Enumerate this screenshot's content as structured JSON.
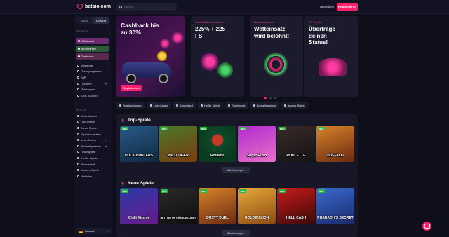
{
  "header": {
    "logo_text": "betsio.com",
    "search_placeholder": "Suche",
    "login_label": "Anmelden",
    "register_label": "Registrieren"
  },
  "sidebar": {
    "toggle": [
      "Sport",
      "Casino"
    ],
    "section_label_promo": "PROMOS",
    "pills": [
      "Glücksrad",
      "$ Einzahlen",
      "Cashback"
    ],
    "items_top": [
      "Angebote",
      "Treueprogramm",
      "VIP",
      "Turniere",
      "Zahlungen",
      "Live-Support"
    ],
    "section_label_games": "SPIELE",
    "items_games": [
      "Kollektionen",
      "Top-Spiele",
      "Neue Spiele",
      "Spielautomaten",
      "Live-Casino",
      "Schnellgewinne",
      "Tischspiele",
      "Heiße Spiele",
      "Bonuskauf",
      "Andere Spiele",
      "Anbieter"
    ],
    "language": "Deutsch"
  },
  "promos": {
    "main_title": "Cashback bis zu 30%",
    "main_cta": "Registrieren",
    "cards": [
      {
        "tag": "Casino Willkommensbonus",
        "title": "225% + 225 FS"
      },
      {
        "tag": "Wetteinsatzbonus",
        "title": "Wetteinsatz wird belohnt!"
      },
      {
        "tag": "VIP Transfer",
        "title": "Übertrage deinen Status!"
      }
    ]
  },
  "categories": [
    "Spielautomaten",
    "Live-Casino",
    "Bonuskauf",
    "Heiße Spiele",
    "Tischspiele",
    "Schnellgewinne",
    "Andere Spiele"
  ],
  "sections": [
    {
      "title": "Top-Spiele",
      "show_all": "Alle Anzeigen",
      "games": [
        {
          "name": "DUCK HUNTERS",
          "badge": "NEU"
        },
        {
          "name": "WILD TIGER",
          "badge": "NEU"
        },
        {
          "name": "Roulette",
          "badge": "NEU"
        },
        {
          "name": "Sugar Rush",
          "badge": "NEU"
        },
        {
          "name": "ROULETTE",
          "badge": "NEU"
        },
        {
          "name": "BUFFALO",
          "badge": "NEU"
        }
      ]
    },
    {
      "title": "Neue Spiele",
      "show_all": "Alle Anzeigen",
      "games": [
        {
          "name": "Chilli Xtreme",
          "badge": "NEU"
        },
        {
          "name": "BETTING ON CHANCE LOBBY",
          "badge": "NEU"
        },
        {
          "name": "DUSTY DUEL",
          "badge": "NEU"
        },
        {
          "name": "GOLDEN LION",
          "badge": "NEU"
        },
        {
          "name": "HELL CASH",
          "badge": "NEU"
        },
        {
          "name": "PHARAOH'S SECRET",
          "badge": "NEU"
        }
      ]
    }
  ],
  "colors": {
    "accent": "#ff1f6b",
    "background": "#0f0f1c",
    "panel": "#171727"
  }
}
